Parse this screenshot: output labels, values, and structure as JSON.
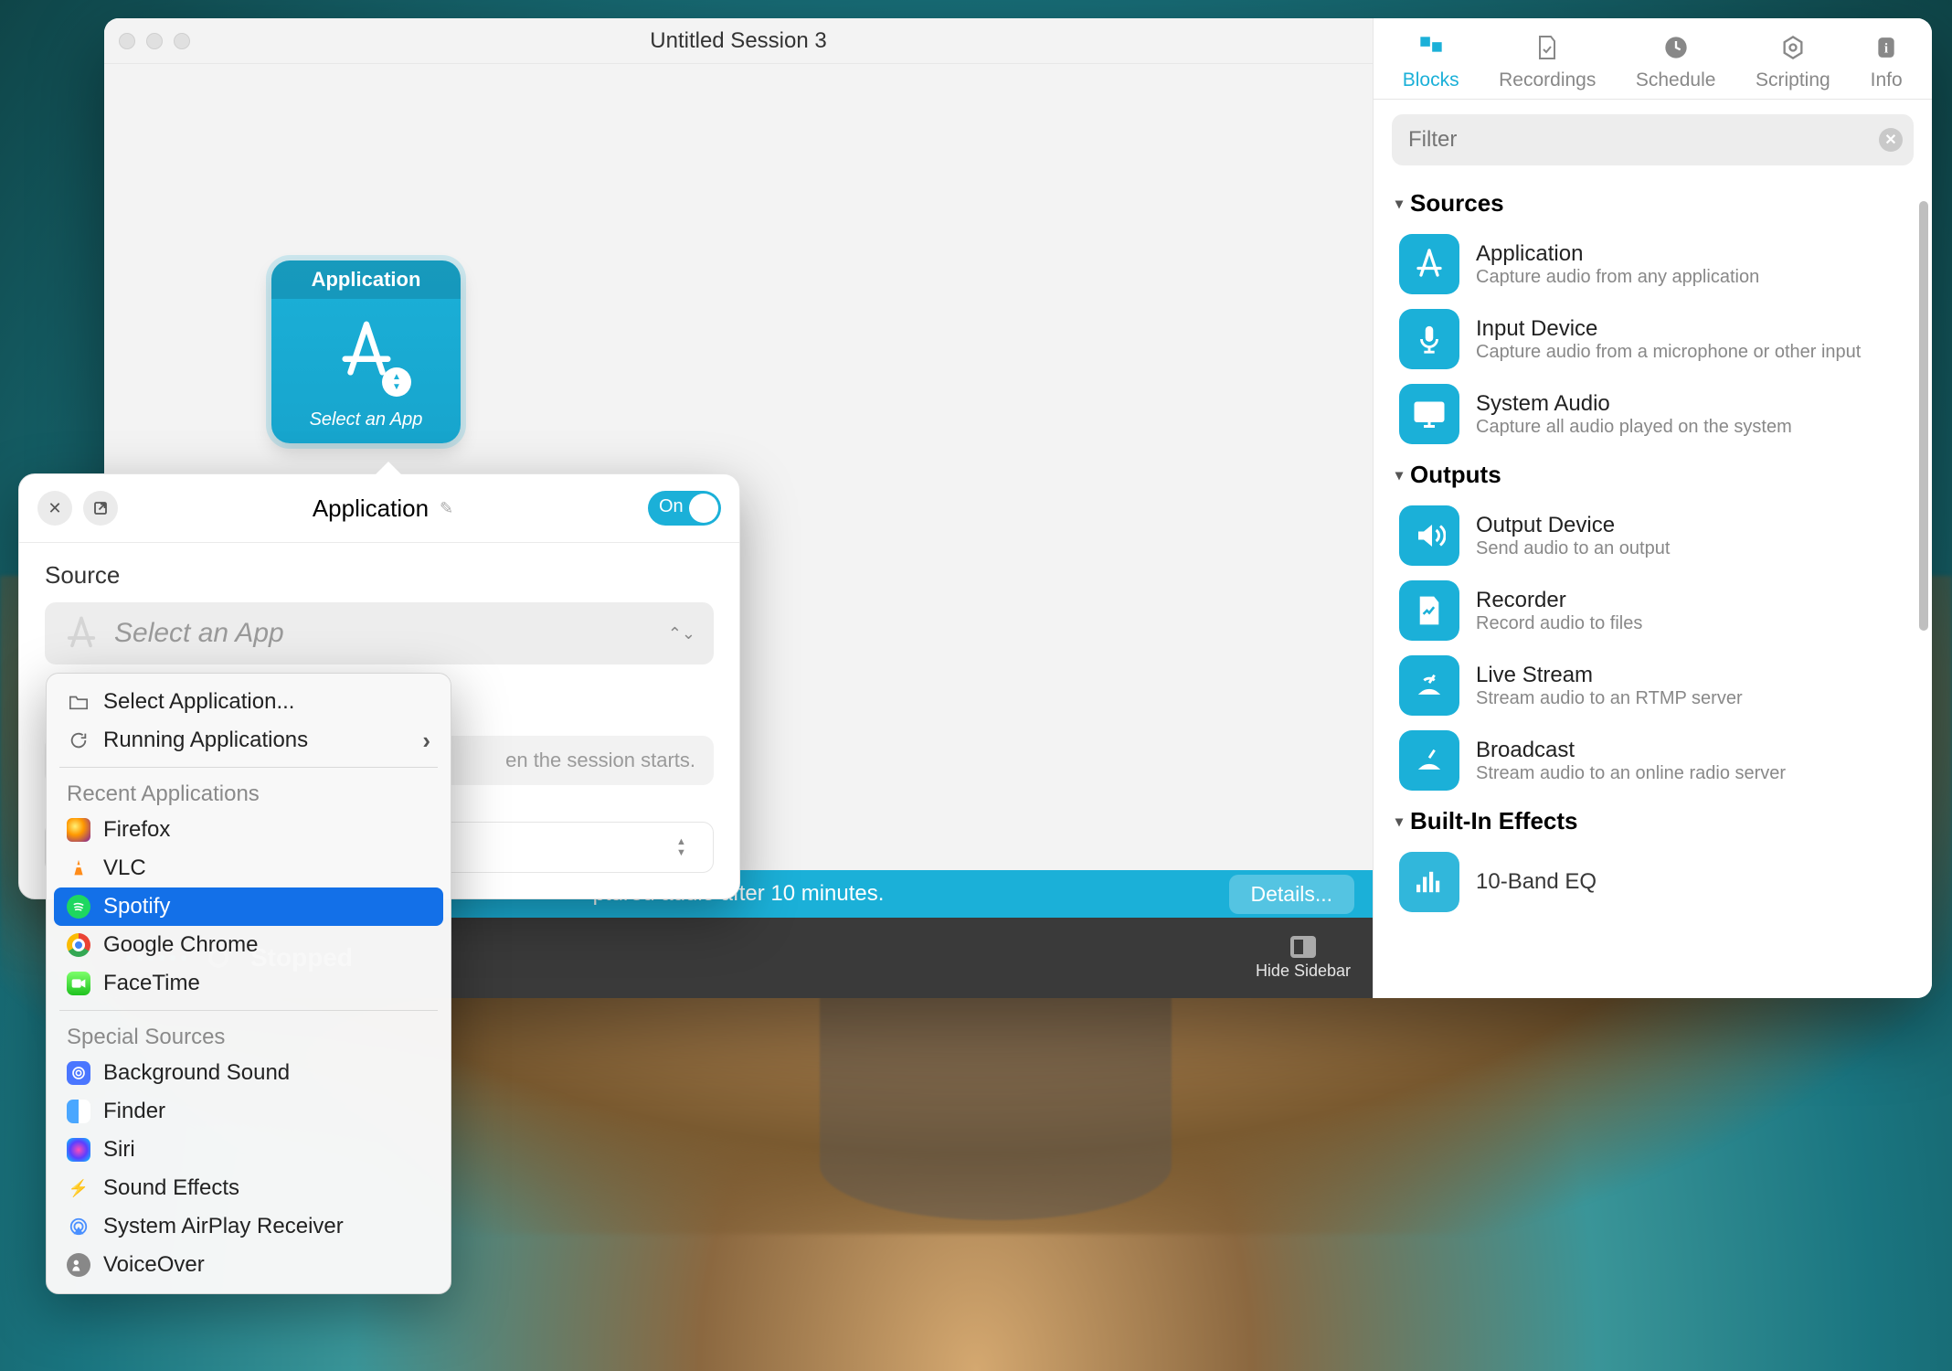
{
  "window": {
    "title": "Untitled Session 3"
  },
  "canvas": {
    "block_header": "Application",
    "block_footer": "Select an App"
  },
  "trial": {
    "text_partial": "ptured audio after 10 minutes.",
    "details": "Details..."
  },
  "status": {
    "state": "Stopped",
    "hide_sidebar": "Hide Sidebar"
  },
  "sidebar": {
    "tabs": {
      "blocks": "Blocks",
      "recordings": "Recordings",
      "schedule": "Schedule",
      "scripting": "Scripting",
      "info": "Info"
    },
    "filter_placeholder": "Filter",
    "sections": {
      "sources": "Sources",
      "outputs": "Outputs",
      "effects": "Built-In Effects"
    },
    "items": {
      "application": {
        "title": "Application",
        "desc": "Capture audio from any application"
      },
      "input_device": {
        "title": "Input Device",
        "desc": "Capture audio from a microphone or other input"
      },
      "system_audio": {
        "title": "System Audio",
        "desc": "Capture all audio played on the system"
      },
      "output_device": {
        "title": "Output Device",
        "desc": "Send audio to an output"
      },
      "recorder": {
        "title": "Recorder",
        "desc": "Record audio to files"
      },
      "live_stream": {
        "title": "Live Stream",
        "desc": "Stream audio to an RTMP server"
      },
      "broadcast": {
        "title": "Broadcast",
        "desc": "Stream audio to an online radio server"
      },
      "eq": {
        "title": "10-Band EQ",
        "desc": ""
      }
    }
  },
  "popover": {
    "title": "Application",
    "toggle": "On",
    "source_label": "Source",
    "select_placeholder": "Select an App",
    "hint_partial": "en the session starts."
  },
  "menu": {
    "select_application": "Select Application...",
    "running_applications": "Running Applications",
    "recent_header": "Recent Applications",
    "recent": {
      "firefox": "Firefox",
      "vlc": "VLC",
      "spotify": "Spotify",
      "chrome": "Google Chrome",
      "facetime": "FaceTime"
    },
    "special_header": "Special Sources",
    "special": {
      "background_sound": "Background Sound",
      "finder": "Finder",
      "siri": "Siri",
      "sound_effects": "Sound Effects",
      "airplay": "System AirPlay Receiver",
      "voiceover": "VoiceOver"
    }
  }
}
